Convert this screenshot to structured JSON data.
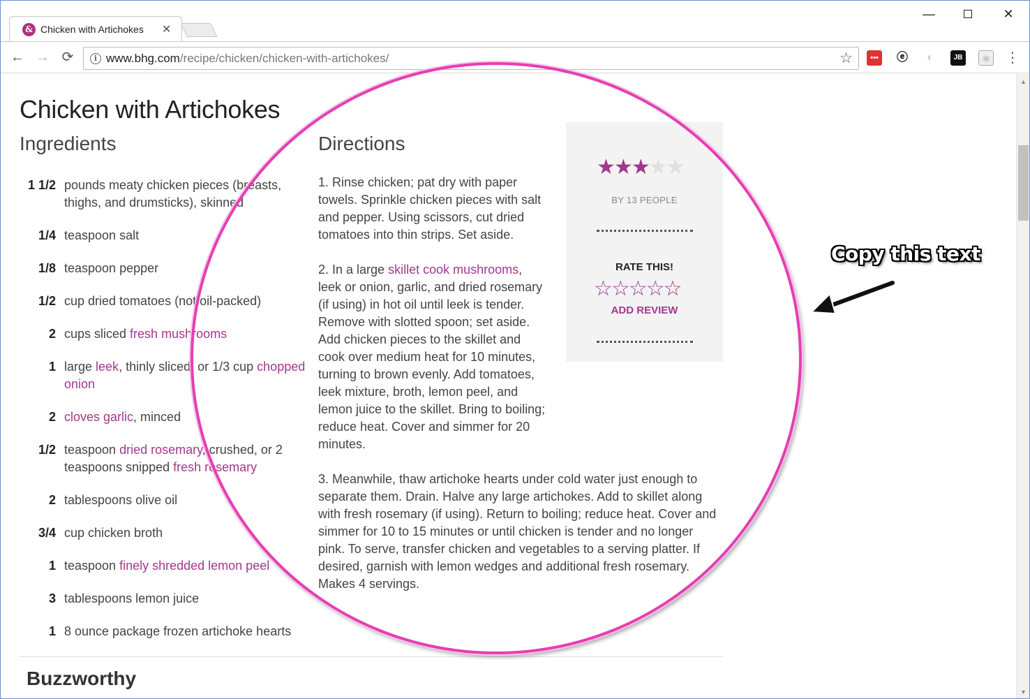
{
  "browser": {
    "tab_title": "Chicken with Artichokes",
    "tab_favicon": "&",
    "url_domain": "www.bhg.com",
    "url_path": "/recipe/chicken/chicken-with-artichokes/",
    "extensions": [
      "lastpass-icon",
      "evernote-icon",
      "extension-icon",
      "jetbrains-icon",
      "react-devtools-icon"
    ]
  },
  "recipe": {
    "title": "Chicken with Artichokes",
    "ingredients_heading": "Ingredients",
    "directions_heading": "Directions",
    "ingredients": [
      {
        "qty": "1 1/2",
        "parts": [
          {
            "t": "pounds meaty chicken pieces (breasts, thighs, and drumsticks), skinned"
          }
        ]
      },
      {
        "qty": "1/4",
        "parts": [
          {
            "t": "teaspoon salt"
          }
        ]
      },
      {
        "qty": "1/8",
        "parts": [
          {
            "t": "teaspoon pepper"
          }
        ]
      },
      {
        "qty": "1/2",
        "parts": [
          {
            "t": "cup dried tomatoes (not oil-packed)"
          }
        ]
      },
      {
        "qty": "2",
        "parts": [
          {
            "t": "cups sliced "
          },
          {
            "t": "fresh mushrooms",
            "link": true
          }
        ]
      },
      {
        "qty": "1",
        "parts": [
          {
            "t": "large "
          },
          {
            "t": "leek",
            "link": true
          },
          {
            "t": ", thinly sliced, or 1/3 cup "
          },
          {
            "t": "chopped onion",
            "link": true
          }
        ]
      },
      {
        "qty": "2",
        "parts": [
          {
            "t": "cloves garlic",
            "link": true
          },
          {
            "t": ", minced"
          }
        ]
      },
      {
        "qty": "1/2",
        "parts": [
          {
            "t": "teaspoon "
          },
          {
            "t": "dried rosemary",
            "link": true
          },
          {
            "t": ", crushed, or 2 teaspoons snipped "
          },
          {
            "t": "fresh rosemary",
            "link": true
          }
        ]
      },
      {
        "qty": "2",
        "parts": [
          {
            "t": "tablespoons olive oil"
          }
        ]
      },
      {
        "qty": "3/4",
        "parts": [
          {
            "t": "cup chicken broth"
          }
        ]
      },
      {
        "qty": "1",
        "parts": [
          {
            "t": "teaspoon "
          },
          {
            "t": "finely shredded lemon peel",
            "link": true
          }
        ]
      },
      {
        "qty": "3",
        "parts": [
          {
            "t": "tablespoons lemon juice"
          }
        ]
      },
      {
        "qty": "1",
        "parts": [
          {
            "t": "8 ounce package frozen artichoke hearts"
          }
        ]
      }
    ],
    "directions": [
      {
        "width": "narrow",
        "parts": [
          {
            "t": "1.  Rinse chicken; pat dry with paper towels. Sprinkle chicken pieces with salt and pepper. Using scissors, cut dried tomatoes into thin strips. Set aside."
          }
        ]
      },
      {
        "width": "narrow",
        "parts": [
          {
            "t": "2.  In a large "
          },
          {
            "t": "skillet cook mushrooms",
            "link": true
          },
          {
            "t": ", leek or onion, garlic, and dried rosemary (if using) in hot oil until leek is tender. Remove with slotted spoon; set aside. Add chicken pieces to the skillet and cook over medium heat for 10 minutes, turning to brown evenly. Add tomatoes, leek mixture, broth, lemon peel, and lemon juice to the skillet. Bring to boiling; reduce heat. Cover and simmer for 20 minutes."
          }
        ]
      },
      {
        "width": "wide",
        "parts": [
          {
            "t": "3.  Meanwhile, thaw artichoke hearts under cold water just enough to separate them. Drain. Halve any large artichokes. Add to skillet along with fresh rosemary (if using). Return to boiling; reduce heat. Cover and simmer for 10 to 15 minutes or until chicken is tender and no longer pink. To serve, transfer chicken and vegetables to a serving platter. If desired, garnish with lemon wedges and additional fresh rosemary. Makes 4 servings."
          }
        ]
      }
    ],
    "rating": {
      "value": 3,
      "max": 5,
      "by_people": "BY 13 PEOPLE",
      "rate_label": "RATE THIS!",
      "add_review": "ADD REVIEW"
    },
    "next_section": "Buzzworthy"
  },
  "annotation": {
    "callout": "Copy this text",
    "circle_color": "#e53fb2"
  },
  "colors": {
    "accent": "#a4378c",
    "star_off": "#e0e0e0"
  }
}
